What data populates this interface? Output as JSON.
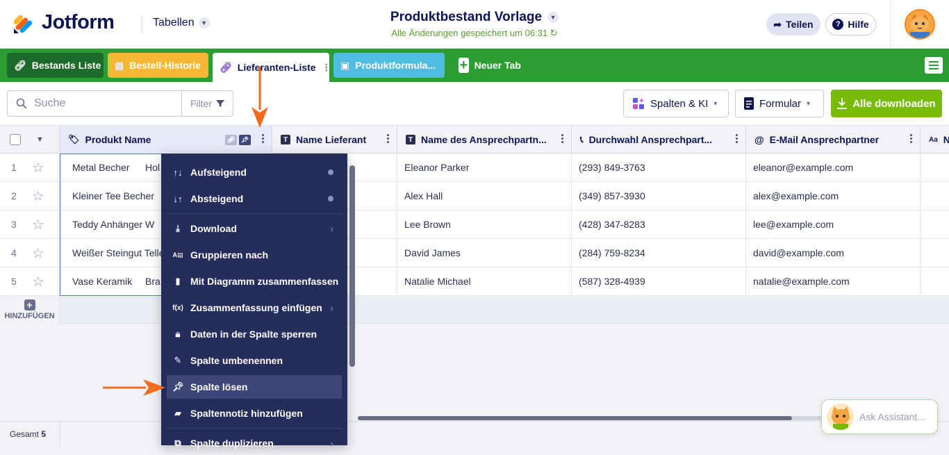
{
  "app": {
    "brand": "Jotform",
    "tables_menu": "Tabellen",
    "doc_title": "Produktbestand Vorlage",
    "save_status": "Alle Änderungen gespeichert um 06:31",
    "share_label": "Teilen",
    "help_label": "Hilfe"
  },
  "tabs": [
    {
      "label": "Bestands Liste",
      "icon": "link-icon"
    },
    {
      "label": "Bestell-Historie",
      "icon": "grid-icon"
    },
    {
      "label": "Lieferanten-Liste",
      "icon": "link-icon"
    },
    {
      "label": "Produktformula...",
      "icon": "calendar-icon"
    },
    {
      "label": "Neuer Tab",
      "icon": "plus-icon"
    }
  ],
  "toolbar": {
    "search_placeholder": "Suche",
    "filter_label": "Filter",
    "columns_ai_label": "Spalten & KI",
    "form_label": "Formular",
    "download_all_label": "Alle downloaden"
  },
  "columns": [
    {
      "label": "Produkt Name"
    },
    {
      "label": "Name Lieferant"
    },
    {
      "label": "Name des Ansprechpartn..."
    },
    {
      "label": "Durchwahl Ansprechpart..."
    },
    {
      "label": "E-Mail Ansprechpartner"
    },
    {
      "label": "N"
    }
  ],
  "rows": [
    {
      "idx": "1",
      "prod": "Metal Becher",
      "prod2": "Hol",
      "ansp": "Eleanor Parker",
      "tel": "(293) 849-3763",
      "mail": "eleanor@example.com"
    },
    {
      "idx": "2",
      "prod": "Kleiner Tee Becher",
      "prod2": "",
      "ansp": "Alex Hall",
      "tel": "(349) 857-3930",
      "mail": "alex@example.com"
    },
    {
      "idx": "3",
      "prod": "Teddy Anhänger",
      "prod2": "W",
      "ansp": "Lee Brown",
      "tel": "(428) 347-8283",
      "mail": "lee@example.com"
    },
    {
      "idx": "4",
      "prod": "Weißer Steingut Telle",
      "prod2": "",
      "ansp": "David James",
      "tel": "(284) 759-8234",
      "mail": "david@example.com"
    },
    {
      "idx": "5",
      "prod": "Vase Keramik",
      "prod2": "Bra",
      "ansp": "Natalie Michael",
      "tel": "(587) 328-4939",
      "mail": "natalie@example.com"
    }
  ],
  "add_row_label": "HINZUFÜGEN",
  "footer": {
    "total_label": "Gesamt",
    "total_value": "5"
  },
  "context_menu": [
    {
      "label": "Aufsteigend",
      "icon": "sort-asc-icon"
    },
    {
      "label": "Absteigend",
      "icon": "sort-desc-icon"
    },
    {
      "label": "Download",
      "icon": "download-icon"
    },
    {
      "label": "Gruppieren nach",
      "icon": "group-icon"
    },
    {
      "label": "Mit Diagramm zusammenfassen",
      "icon": "bar-chart-icon"
    },
    {
      "label": "Zusammenfassung einfügen",
      "icon": "function-icon"
    },
    {
      "label": "Daten in der Spalte sperren",
      "icon": "lock-icon"
    },
    {
      "label": "Spalte umbenennen",
      "icon": "pencil-icon"
    },
    {
      "label": "Spalte lösen",
      "icon": "pin-icon"
    },
    {
      "label": "Spaltennotiz hinzufügen",
      "icon": "note-icon"
    },
    {
      "label": "Spalte duplizieren",
      "icon": "duplicate-icon"
    }
  ],
  "assistant_label": "Ask Assistant...",
  "colors": {
    "tabbar": "#2b9d33",
    "menu_bg": "#252d5b",
    "download": "#78bb07",
    "arrow": "#f46a1e"
  }
}
